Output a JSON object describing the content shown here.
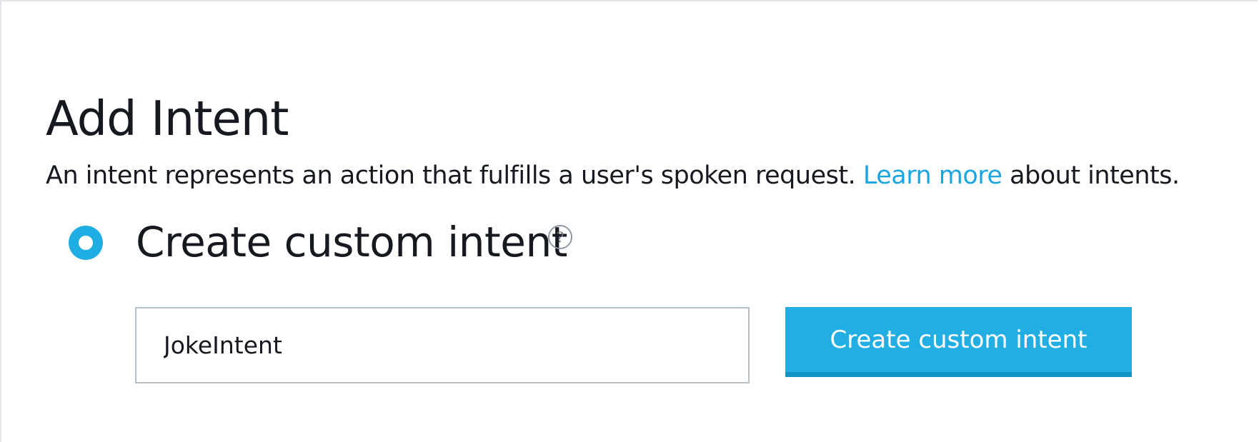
{
  "page": {
    "title": "Add Intent",
    "description_before_link": "An intent represents an action that fulfills a user's spoken request. ",
    "description_link": "Learn more",
    "description_after_link": " about intents."
  },
  "custom_intent": {
    "option_label": "Create custom intent",
    "selected": true,
    "help_icon": "question-circle",
    "input_value": "JokeIntent",
    "button_label": "Create custom intent"
  },
  "colors": {
    "accent": "#1faee3",
    "link": "#1ba6e0",
    "text": "#16191f",
    "input_border": "#b7c0c8"
  }
}
